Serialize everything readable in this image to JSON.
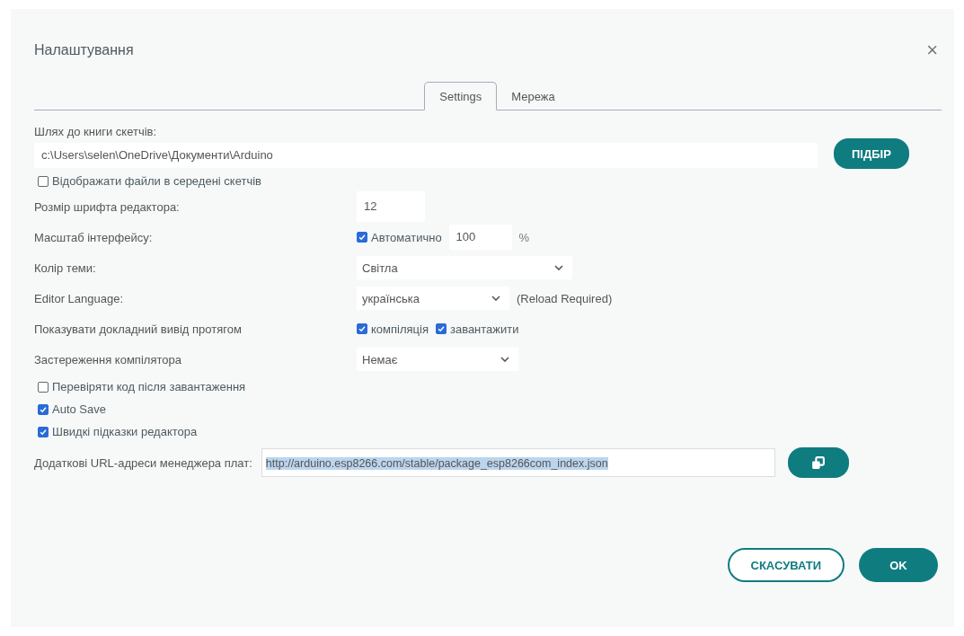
{
  "window": {
    "title": "Налаштування",
    "close": "×"
  },
  "tabs": [
    {
      "label": "Settings",
      "selected": true
    },
    {
      "label": "Мережа",
      "selected": false
    }
  ],
  "sketchbook": {
    "label": "Шлях до книги скетчів:",
    "value": "c:\\Users\\selen\\OneDrive\\Документи\\Arduino",
    "button": "ПІДБІР"
  },
  "show_files": {
    "label": "Відображати файли в середені скетчів",
    "checked": false
  },
  "font_size": {
    "label": "Розмір шрифта редактора:",
    "value": "12"
  },
  "scale": {
    "label": "Масштаб інтерфейсу:",
    "auto_label": "Автоматично",
    "auto_checked": true,
    "value": "100",
    "unit": "%"
  },
  "theme": {
    "label": "Колір теми:",
    "value": "Світла"
  },
  "language": {
    "label": "Editor Language:",
    "value": "українська",
    "note": "(Reload Required)"
  },
  "verbose": {
    "label": "Показувати докладний вивід протягом",
    "options": [
      {
        "label": "компіляція",
        "checked": true
      },
      {
        "label": "завантажити",
        "checked": true
      }
    ]
  },
  "warnings": {
    "label": "Застереження компілятора",
    "value": "Немає"
  },
  "options": [
    {
      "label": "Перевіряти код після завантаження",
      "checked": false
    },
    {
      "label": "Auto Save",
      "checked": true
    },
    {
      "label": "Швидкі підказки редактора",
      "checked": true
    }
  ],
  "urls": {
    "label": "Додаткові URL-адреси менеджера плат:",
    "value": "http://arduino.esp8266.com/stable/package_esp8266com_index.json",
    "text_selected": true
  },
  "buttons": [
    {
      "label": "СКАСУВАТИ",
      "kind": "secondary"
    },
    {
      "label": "OK",
      "kind": "primary"
    }
  ]
}
